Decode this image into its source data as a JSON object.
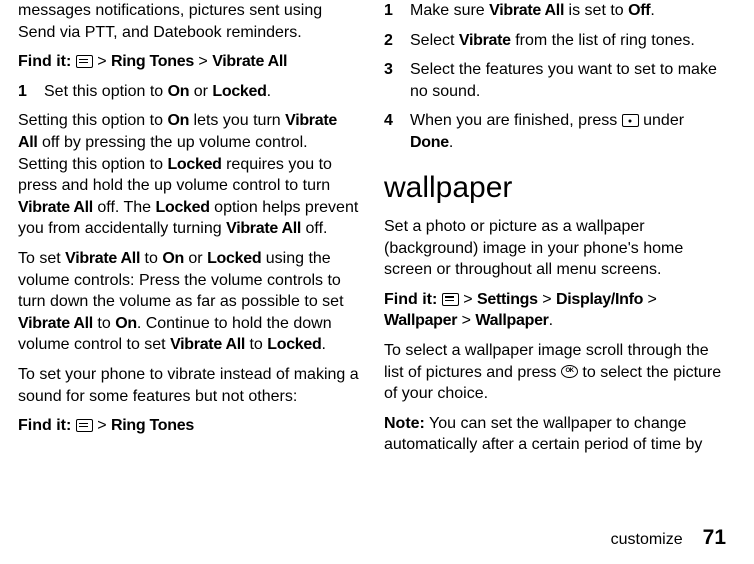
{
  "left": {
    "intro": "messages notifications, pictures sent using Send via PTT, and Datebook reminders.",
    "find1_prefix": "Find it:",
    "find1_path1": "Ring Tones",
    "find1_path2": "Vibrate All",
    "step1_num": "1",
    "step1_body_a": "Set this option to ",
    "step1_body_b": "On",
    "step1_body_c": " or ",
    "step1_body_d": "Locked",
    "step1_body_e": ".",
    "detail_a": "Setting this option to ",
    "detail_b": "On",
    "detail_c": " lets you turn ",
    "detail_d": "Vibrate All",
    "detail_e": " off by pressing the up volume control. Setting this option to ",
    "detail_f": "Locked",
    "detail_g": " requires you to press and hold the up volume control to turn ",
    "detail_h": "Vibrate All",
    "detail_i": " off. The ",
    "detail_j": "Locked",
    "detail_k": " option helps prevent you from accidentally turning ",
    "detail_l": "Vibrate All",
    "detail_m": " off.",
    "volset_a": "To set ",
    "volset_b": "Vibrate All",
    "volset_c": " to ",
    "volset_d": "On",
    "volset_e": " or ",
    "volset_f": "Locked",
    "volset_g": " using the volume controls: Press the volume controls to turn down the volume as far as possible to set ",
    "volset_h": "Vibrate All",
    "volset_i": " to ",
    "volset_j": "On",
    "volset_k": ". Continue to hold the down volume control to set ",
    "volset_l": "Vibrate All",
    "volset_m": " to ",
    "volset_n": "Locked",
    "volset_o": ".",
    "some": "To set your phone to vibrate instead of making a sound for some features but not others:",
    "find2_prefix": "Find it:",
    "find2_path": "Ring Tones"
  },
  "right": {
    "s1_num": "1",
    "s1_a": "Make sure ",
    "s1_b": "Vibrate All",
    "s1_c": " is set to ",
    "s1_d": "Off",
    "s1_e": ".",
    "s2_num": "2",
    "s2_a": "Select ",
    "s2_b": "Vibrate",
    "s2_c": " from the list of ring tones.",
    "s3_num": "3",
    "s3": "Select the features you want to set to make no sound.",
    "s4_num": "4",
    "s4_a": "When you are finished, press ",
    "s4_b": " under ",
    "s4_c": "Done",
    "s4_d": ".",
    "heading": "wallpaper",
    "wp1": "Set a photo or picture as a wallpaper (background) image in your phone's home screen or throughout all menu screens.",
    "find_prefix": "Find it:",
    "find_p1": "Settings",
    "find_p2": "Display/Info",
    "find_p3": "Wallpaper",
    "find_p4": "Wallpaper",
    "find_dot": ".",
    "sel_a": "To select a wallpaper image scroll through the list of pictures and press ",
    "sel_b": " to select the picture of your choice.",
    "note_label": "Note:",
    "note_body": " You can set the wallpaper to change automatically after a certain period of time by"
  },
  "footer": {
    "label": "customize",
    "page": "71"
  }
}
